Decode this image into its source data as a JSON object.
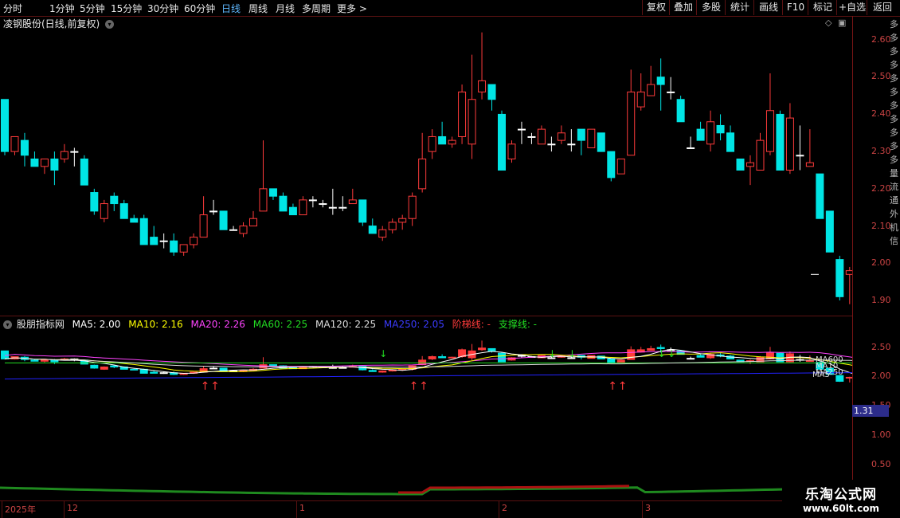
{
  "toolbar": {
    "periods": [
      "分时",
      "1分钟",
      "5分钟",
      "15分钟",
      "30分钟",
      "60分钟",
      "日线",
      "周线",
      "月线",
      "多周期",
      "更多 >"
    ],
    "active_period": "日线",
    "buttons": [
      "复权",
      "叠加",
      "多股",
      "统计",
      "画线",
      "F10",
      "标记",
      "+自选",
      "返回"
    ]
  },
  "main_pane": {
    "title": "凌钢股份(日线,前复权)",
    "price_labels": [
      "2.60",
      "2.50",
      "2.40",
      "2.30",
      "2.20",
      "2.10",
      "2.00",
      "1.90"
    ]
  },
  "indicator_pane": {
    "name": "股朋指标网",
    "ma5": "MA5: 2.00",
    "ma10": "MA10: 2.16",
    "ma20": "MA20: 2.26",
    "ma60": "MA60: 2.25",
    "ma120": "MA120: 2.25",
    "ma250": "MA250: 2.05",
    "ladder": "阶梯线: -",
    "support": "支撑线: -",
    "price_labels": [
      "2.50",
      "2.00",
      "1.50",
      "1.00",
      "0.50"
    ],
    "current_value": "1.31",
    "line_labels": [
      "MA600",
      "MA10",
      "MA250",
      "MA5"
    ]
  },
  "x_axis": [
    "2025年",
    "12",
    "1",
    "2",
    "3"
  ],
  "side_panel_text": "多多多多多多多多多多多量流通外机信",
  "watermark": {
    "line1": "乐淘公式网",
    "line2": "www.60lt.com"
  },
  "colors": {
    "up": "#ff3b3b",
    "down": "#00e5e5",
    "ma5": "#ffffff",
    "ma10": "#ffff00",
    "ma20": "#ff44ff",
    "ma60": "#22dd22",
    "ma120": "#dddddd",
    "ma250": "#2222ff"
  },
  "chart_data": {
    "type": "candlestick",
    "ylim": [
      1.85,
      2.65
    ],
    "candles": [
      [
        2.44,
        2.42,
        2.29,
        2.3
      ],
      [
        2.3,
        2.34,
        2.29,
        2.34
      ],
      [
        2.33,
        2.35,
        2.26,
        2.29
      ],
      [
        2.28,
        2.3,
        2.26,
        2.26
      ],
      [
        2.26,
        2.28,
        2.24,
        2.28
      ],
      [
        2.28,
        2.3,
        2.21,
        2.25
      ],
      [
        2.28,
        2.32,
        2.27,
        2.3
      ],
      [
        2.3,
        2.31,
        2.26,
        2.3
      ],
      [
        2.28,
        2.29,
        2.21,
        2.21
      ],
      [
        2.19,
        2.2,
        2.13,
        2.14
      ],
      [
        2.12,
        2.17,
        2.11,
        2.16
      ],
      [
        2.18,
        2.19,
        2.14,
        2.16
      ],
      [
        2.16,
        2.17,
        2.12,
        2.12
      ],
      [
        2.12,
        2.13,
        2.11,
        2.11
      ],
      [
        2.12,
        2.13,
        2.05,
        2.05
      ],
      [
        2.07,
        2.1,
        2.05,
        2.05
      ],
      [
        2.06,
        2.08,
        2.04,
        2.06
      ],
      [
        2.06,
        2.08,
        2.02,
        2.03
      ],
      [
        2.03,
        2.05,
        2.02,
        2.05
      ],
      [
        2.05,
        2.08,
        2.04,
        2.07
      ],
      [
        2.07,
        2.18,
        2.07,
        2.13
      ],
      [
        2.14,
        2.17,
        2.13,
        2.14
      ],
      [
        2.14,
        2.14,
        2.09,
        2.09
      ],
      [
        2.09,
        2.1,
        2.09,
        2.09
      ],
      [
        2.08,
        2.11,
        2.07,
        2.1
      ],
      [
        2.1,
        2.14,
        2.1,
        2.12
      ],
      [
        2.14,
        2.33,
        2.14,
        2.2
      ],
      [
        2.2,
        2.2,
        2.17,
        2.18
      ],
      [
        2.18,
        2.19,
        2.14,
        2.14
      ],
      [
        2.15,
        2.16,
        2.13,
        2.13
      ],
      [
        2.13,
        2.18,
        2.13,
        2.17
      ],
      [
        2.17,
        2.18,
        2.15,
        2.17
      ],
      [
        2.16,
        2.17,
        2.15,
        2.16
      ],
      [
        2.15,
        2.2,
        2.13,
        2.15
      ],
      [
        2.15,
        2.18,
        2.14,
        2.15
      ],
      [
        2.16,
        2.2,
        2.16,
        2.17
      ],
      [
        2.17,
        2.17,
        2.1,
        2.11
      ],
      [
        2.1,
        2.12,
        2.08,
        2.08
      ],
      [
        2.07,
        2.1,
        2.06,
        2.09
      ],
      [
        2.09,
        2.12,
        2.08,
        2.11
      ],
      [
        2.11,
        2.13,
        2.09,
        2.12
      ],
      [
        2.12,
        2.19,
        2.1,
        2.18
      ],
      [
        2.2,
        2.35,
        2.19,
        2.28
      ],
      [
        2.3,
        2.36,
        2.28,
        2.34
      ],
      [
        2.34,
        2.38,
        2.32,
        2.32
      ],
      [
        2.32,
        2.34,
        2.31,
        2.33
      ],
      [
        2.34,
        2.48,
        2.32,
        2.46
      ],
      [
        2.32,
        2.56,
        2.28,
        2.44
      ],
      [
        2.46,
        2.62,
        2.44,
        2.49
      ],
      [
        2.48,
        2.48,
        2.41,
        2.44
      ],
      [
        2.4,
        2.41,
        2.25,
        2.25
      ],
      [
        2.28,
        2.33,
        2.27,
        2.32
      ],
      [
        2.36,
        2.38,
        2.32,
        2.36
      ],
      [
        2.34,
        2.35,
        2.32,
        2.34
      ],
      [
        2.32,
        2.37,
        2.32,
        2.36
      ],
      [
        2.32,
        2.34,
        2.3,
        2.32
      ],
      [
        2.33,
        2.37,
        2.32,
        2.35
      ],
      [
        2.32,
        2.36,
        2.3,
        2.32
      ],
      [
        2.36,
        2.36,
        2.29,
        2.33
      ],
      [
        2.31,
        2.34,
        2.31,
        2.36
      ],
      [
        2.35,
        2.35,
        2.3,
        2.3
      ],
      [
        2.3,
        2.3,
        2.22,
        2.23
      ],
      [
        2.24,
        2.28,
        2.24,
        2.28
      ],
      [
        2.29,
        2.52,
        2.29,
        2.46
      ],
      [
        2.42,
        2.51,
        2.41,
        2.46
      ],
      [
        2.45,
        2.53,
        2.45,
        2.48
      ],
      [
        2.5,
        2.55,
        2.41,
        2.48
      ],
      [
        2.46,
        2.5,
        2.44,
        2.46
      ],
      [
        2.44,
        2.45,
        2.38,
        2.38
      ],
      [
        2.31,
        2.34,
        2.31,
        2.31
      ],
      [
        2.36,
        2.38,
        2.33,
        2.33
      ],
      [
        2.32,
        2.41,
        2.3,
        2.38
      ],
      [
        2.37,
        2.4,
        2.33,
        2.35
      ],
      [
        2.35,
        2.37,
        2.3,
        2.3
      ],
      [
        2.28,
        2.28,
        2.25,
        2.25
      ],
      [
        2.26,
        2.29,
        2.21,
        2.27
      ],
      [
        2.25,
        2.35,
        2.25,
        2.33
      ],
      [
        2.3,
        2.51,
        2.29,
        2.41
      ],
      [
        2.4,
        2.41,
        2.25,
        2.25
      ],
      [
        2.25,
        2.43,
        2.24,
        2.39
      ],
      [
        2.29,
        2.37,
        2.25,
        2.29
      ],
      [
        2.26,
        2.36,
        2.26,
        2.27
      ],
      [
        2.24,
        2.24,
        2.12,
        2.12
      ],
      [
        2.14,
        2.14,
        2.03,
        2.03
      ],
      [
        2.01,
        2.02,
        1.9,
        1.91
      ],
      [
        1.97,
        1.99,
        1.89,
        1.98
      ],
      [
        1.97,
        1.97,
        1.97,
        1.97
      ]
    ]
  }
}
